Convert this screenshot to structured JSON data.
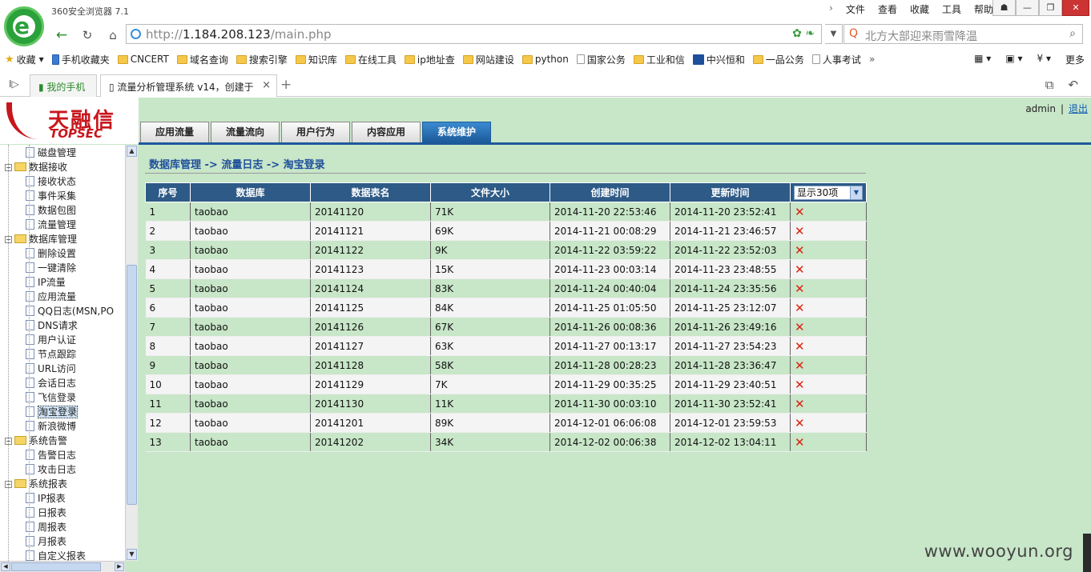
{
  "browser": {
    "app_title": "360安全浏览器 7.1",
    "menu": [
      "文件",
      "查看",
      "收藏",
      "工具",
      "帮助"
    ],
    "window_buttons": [
      "☗",
      "—",
      "❐",
      "✕"
    ],
    "url_prefix": "http://",
    "url_host": "1.184.208.123",
    "url_path": "/main.php",
    "search_placeholder": "北方大部迎来雨雪降温",
    "favorites": [
      {
        "label": "收藏",
        "icon": "star"
      },
      {
        "label": "手机收藏夹",
        "icon": "phone"
      },
      {
        "label": "CNCERT",
        "icon": "folder"
      },
      {
        "label": "域名查询",
        "icon": "folder"
      },
      {
        "label": "搜索引擎",
        "icon": "folder"
      },
      {
        "label": "知识库",
        "icon": "folder"
      },
      {
        "label": "在线工具",
        "icon": "folder"
      },
      {
        "label": "ip地址查",
        "icon": "folder"
      },
      {
        "label": "网站建设",
        "icon": "folder"
      },
      {
        "label": "python",
        "icon": "folder"
      },
      {
        "label": "国家公务",
        "icon": "page"
      },
      {
        "label": "工业和信",
        "icon": "folder"
      },
      {
        "label": "中兴恒和",
        "icon": "logo"
      },
      {
        "label": "一品公务",
        "icon": "folder"
      },
      {
        "label": "人事考试",
        "icon": "page"
      }
    ],
    "fav_more_arrow": "»",
    "fav_right_more": "更多",
    "tabs": [
      {
        "label": "我的手机"
      },
      {
        "label": "流量分析管理系统 v14，创建于",
        "close": "×"
      }
    ],
    "new_tab": "+"
  },
  "app": {
    "brand_cn": "天融信",
    "brand_en": "TOPSEC",
    "user": "admin",
    "user_sep": "|",
    "logout": "退出",
    "nav_tabs": [
      "应用流量",
      "流量流向",
      "用户行为",
      "内容应用",
      "系统维护"
    ],
    "active_tab": "系统维护",
    "breadcrumb": "数据库管理 -> 流量日志 -> 淘宝登录"
  },
  "tree": [
    {
      "label": "磁盘管理",
      "level": 1
    },
    {
      "label": "数据接收",
      "level": 0
    },
    {
      "label": "接收状态",
      "level": 1
    },
    {
      "label": "事件采集",
      "level": 1
    },
    {
      "label": "数据包图",
      "level": 1
    },
    {
      "label": "流量管理",
      "level": 1
    },
    {
      "label": "数据库管理",
      "level": 0
    },
    {
      "label": "删除设置",
      "level": 1
    },
    {
      "label": "一键清除",
      "level": 1
    },
    {
      "label": "IP流量",
      "level": 1
    },
    {
      "label": "应用流量",
      "level": 1
    },
    {
      "label": "QQ日志(MSN,PO",
      "level": 1
    },
    {
      "label": "DNS请求",
      "level": 1
    },
    {
      "label": "用户认证",
      "level": 1
    },
    {
      "label": "节点跟踪",
      "level": 1
    },
    {
      "label": "URL访问",
      "level": 1
    },
    {
      "label": "会话日志",
      "level": 1
    },
    {
      "label": "飞信登录",
      "level": 1
    },
    {
      "label": "淘宝登录",
      "level": 1,
      "selected": true
    },
    {
      "label": "新浪微博",
      "level": 1
    },
    {
      "label": "系统告警",
      "level": 0
    },
    {
      "label": "告警日志",
      "level": 1
    },
    {
      "label": "攻击日志",
      "level": 1
    },
    {
      "label": "系统报表",
      "level": 0
    },
    {
      "label": "IP报表",
      "level": 1
    },
    {
      "label": "日报表",
      "level": 1
    },
    {
      "label": "周报表",
      "level": 1
    },
    {
      "label": "月报表",
      "level": 1
    },
    {
      "label": "自定义报表",
      "level": 1
    }
  ],
  "table": {
    "headers": [
      "序号",
      "数据库",
      "数据表名",
      "文件大小",
      "创建时间",
      "更新时间"
    ],
    "page_size_label": "显示30项",
    "rows": [
      [
        "1",
        "taobao",
        "20141120",
        "71K",
        "2014-11-20 22:53:46",
        "2014-11-20 23:52:41"
      ],
      [
        "2",
        "taobao",
        "20141121",
        "69K",
        "2014-11-21 00:08:29",
        "2014-11-21 23:46:57"
      ],
      [
        "3",
        "taobao",
        "20141122",
        "9K",
        "2014-11-22 03:59:22",
        "2014-11-22 23:52:03"
      ],
      [
        "4",
        "taobao",
        "20141123",
        "15K",
        "2014-11-23 00:03:14",
        "2014-11-23 23:48:55"
      ],
      [
        "5",
        "taobao",
        "20141124",
        "83K",
        "2014-11-24 00:40:04",
        "2014-11-24 23:35:56"
      ],
      [
        "6",
        "taobao",
        "20141125",
        "84K",
        "2014-11-25 01:05:50",
        "2014-11-25 23:12:07"
      ],
      [
        "7",
        "taobao",
        "20141126",
        "67K",
        "2014-11-26 00:08:36",
        "2014-11-26 23:49:16"
      ],
      [
        "8",
        "taobao",
        "20141127",
        "63K",
        "2014-11-27 00:13:17",
        "2014-11-27 23:54:23"
      ],
      [
        "9",
        "taobao",
        "20141128",
        "58K",
        "2014-11-28 00:28:23",
        "2014-11-28 23:36:47"
      ],
      [
        "10",
        "taobao",
        "20141129",
        "7K",
        "2014-11-29 00:35:25",
        "2014-11-29 23:40:51"
      ],
      [
        "11",
        "taobao",
        "20141130",
        "11K",
        "2014-11-30 00:03:10",
        "2014-11-30 23:52:41"
      ],
      [
        "12",
        "taobao",
        "20141201",
        "89K",
        "2014-12-01 06:06:08",
        "2014-12-01 23:59:53"
      ],
      [
        "13",
        "taobao",
        "20141202",
        "34K",
        "2014-12-02 00:06:38",
        "2014-12-02 13:04:11"
      ]
    ],
    "delete_glyph": "✕"
  },
  "watermark": "www.wooyun.org",
  "colors": {
    "accent": "#1c5a9a",
    "page_bg": "#c8e6c8",
    "delete": "#dd2211"
  }
}
